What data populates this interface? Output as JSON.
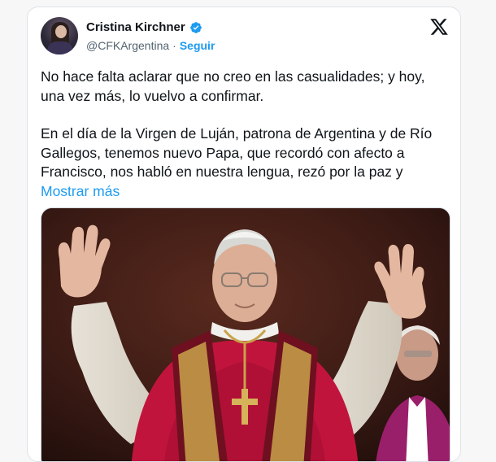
{
  "tweet": {
    "author": {
      "display_name": "Cristina Kirchner",
      "handle": "@CFKArgentina",
      "separator": "·",
      "follow_label": "Seguir",
      "verified": true
    },
    "text": {
      "paragraph1": "No hace falta aclarar que no creo en las casualidades; y hoy, una vez más, lo vuelvo a confirmar.",
      "paragraph2": "En el día de la Virgen de Luján, patrona de Argentina y de Río Gallegos, tenemos nuevo Papa, que recordó con afecto a Francisco, nos habló en nuestra lengua, rezó por la paz y",
      "show_more": "Mostrar más"
    },
    "platform_icon": "x-logo-icon",
    "media_icon": "photo-pope-balcony"
  },
  "colors": {
    "link": "#1d9bf0",
    "verified": "#1d9bf0",
    "text": "#0f1419",
    "muted": "#536471"
  }
}
